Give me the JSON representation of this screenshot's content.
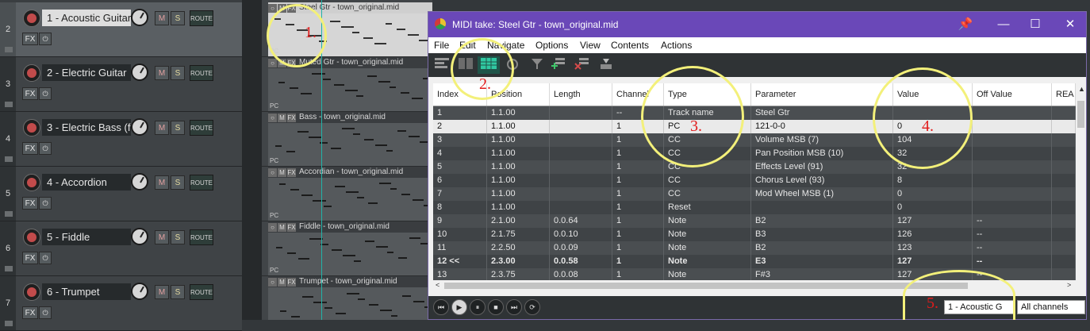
{
  "tracks": [
    {
      "num": "2",
      "name": "1 - Acoustic Guitar",
      "selected": true,
      "item_title": "Steel Gtr - town_original.mid"
    },
    {
      "num": "3",
      "name": "2 - Electric Guitar",
      "selected": false,
      "item_title": "Muted Gtr - town_original.mid"
    },
    {
      "num": "4",
      "name": "3 - Electric Bass (f",
      "selected": false,
      "item_title": "Bass - town_original.mid"
    },
    {
      "num": "5",
      "name": "4 - Accordion",
      "selected": false,
      "item_title": "Accordian - town_original.mid"
    },
    {
      "num": "6",
      "name": "5 - Fiddle",
      "selected": false,
      "item_title": "Fiddle - town_original.mid"
    },
    {
      "num": "7",
      "name": "6 - Trumpet",
      "selected": false,
      "item_title": "Trumpet - town_original.mid"
    }
  ],
  "track_buttons": {
    "mute": "M",
    "solo": "S",
    "route": "ROUTE",
    "fx": "FX",
    "item_m": "M",
    "item_fx": "FX",
    "pc_label": "PC"
  },
  "midi_window": {
    "title": "MIDI take: Steel Gtr - town_original.mid",
    "menus": [
      "File",
      "Edit",
      "Navigate",
      "Options",
      "View",
      "Contents",
      "Actions"
    ],
    "columns": [
      "Index",
      "Position",
      "Length",
      "Channel",
      "Type",
      "Parameter",
      "Value",
      "Off Value",
      "REA"
    ],
    "rows": [
      [
        "1",
        "1.1.00",
        "",
        "--",
        "Track name",
        "Steel Gtr",
        "",
        "",
        ""
      ],
      [
        "2",
        "1.1.00",
        "",
        "1",
        "PC",
        "121-0-0",
        "0",
        "",
        ""
      ],
      [
        "3",
        "1.1.00",
        "",
        "1",
        "CC",
        "Volume MSB (7)",
        "104",
        "",
        ""
      ],
      [
        "4",
        "1.1.00",
        "",
        "1",
        "CC",
        "Pan Position MSB (10)",
        "32",
        "",
        ""
      ],
      [
        "5",
        "1.1.00",
        "",
        "1",
        "CC",
        "Effects Level (91)",
        "32",
        "",
        ""
      ],
      [
        "6",
        "1.1.00",
        "",
        "1",
        "CC",
        "Chorus Level (93)",
        "8",
        "",
        ""
      ],
      [
        "7",
        "1.1.00",
        "",
        "1",
        "CC",
        "Mod Wheel MSB (1)",
        "0",
        "",
        ""
      ],
      [
        "8",
        "1.1.00",
        "",
        "1",
        "Reset",
        "",
        "0",
        "",
        ""
      ],
      [
        "9",
        "2.1.00",
        "0.0.64",
        "1",
        "Note",
        "B2",
        "127",
        "--",
        ""
      ],
      [
        "10",
        "2.1.75",
        "0.0.10",
        "1",
        "Note",
        "B3",
        "126",
        "--",
        ""
      ],
      [
        "11",
        "2.2.50",
        "0.0.09",
        "1",
        "Note",
        "B2",
        "123",
        "--",
        ""
      ],
      [
        "12 <<",
        "2.3.00",
        "0.0.58",
        "1",
        "Note",
        "E3",
        "127",
        "--",
        ""
      ],
      [
        "13",
        "2.3.75",
        "0.0.08",
        "1",
        "Note",
        "F#3",
        "127",
        "--",
        ""
      ]
    ],
    "selected_row": 1,
    "bold_row": 11,
    "track_select": "1 - Acoustic G",
    "channel_select": "All channels"
  },
  "annotations": [
    "1.",
    "2.",
    "3.",
    "4.",
    "5."
  ],
  "icons": {
    "pin": "📌",
    "minimize": "—",
    "maximize": "☐",
    "close": "✕",
    "power": "⏻",
    "filter": "▼",
    "scroll_up": "▲",
    "scroll_left": "<",
    "scroll_right": ">",
    "transport_start": "⏮",
    "transport_play": "▶",
    "transport_pause": "⏸",
    "transport_stop": "■",
    "transport_end": "⏭",
    "transport_loop": "⟳"
  }
}
